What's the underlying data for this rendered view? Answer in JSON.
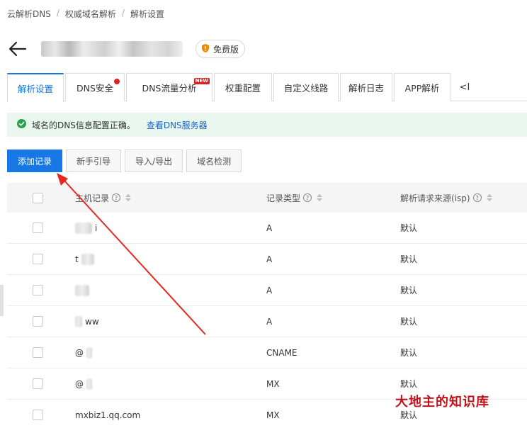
{
  "breadcrumb": [
    "云解析DNS",
    "权威域名解析",
    "解析设置"
  ],
  "header": {
    "badge_label": "免费版"
  },
  "tabs": [
    {
      "label": "解析设置",
      "active": true
    },
    {
      "label": "DNS安全",
      "dot": true
    },
    {
      "label": "DNS流量分析",
      "new_tag": "NEW"
    },
    {
      "label": "权重配置"
    },
    {
      "label": "自定义线路"
    },
    {
      "label": "解析日志"
    },
    {
      "label": "APP解析"
    }
  ],
  "tabs_collapse": "<I",
  "alert": {
    "message": "域名的DNS信息配置正确。",
    "link": "查看DNS服务器"
  },
  "toolbar": {
    "add": "添加记录",
    "guide": "新手引导",
    "import_export": "导入/导出",
    "detect": "域名检测"
  },
  "table": {
    "columns": [
      "主机记录",
      "记录类型",
      "解析请求来源(isp)"
    ],
    "rows": [
      {
        "host": "i",
        "type": "A",
        "line": "默认"
      },
      {
        "host": "t",
        "type": "A",
        "line": "默认"
      },
      {
        "host": "",
        "type": "A",
        "line": "默认"
      },
      {
        "host": "ww",
        "type": "A",
        "line": "默认"
      },
      {
        "host": "@",
        "type": "CNAME",
        "line": "默认"
      },
      {
        "host": "@",
        "type": "MX",
        "line": "默认"
      },
      {
        "host": "mxbiz1.qq.com",
        "type": "MX",
        "line": "默认"
      }
    ]
  },
  "watermark": "大地主的知识库",
  "colors": {
    "accent": "#1677e5",
    "alert_bg": "#eaf7ee",
    "success": "#2e9e4f",
    "annotation_arrow": "#e8281e"
  }
}
